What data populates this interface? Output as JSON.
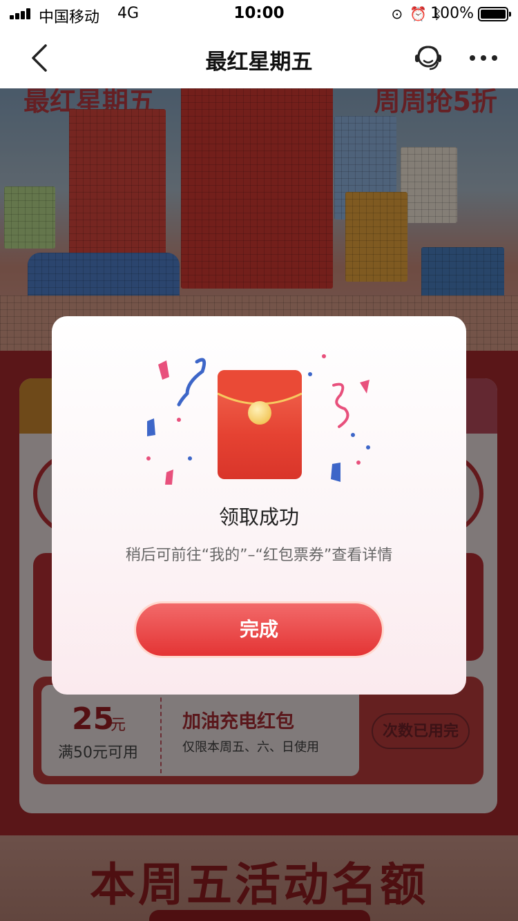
{
  "status_bar": {
    "carrier": "中国移动",
    "network": "4G",
    "time": "10:00",
    "battery": "100%"
  },
  "nav": {
    "title": "最红星期五"
  },
  "hero": {
    "top_left_text": "最红星期五",
    "top_right_text": "周周抢5折"
  },
  "coupon": {
    "amount": "25",
    "unit": "元",
    "condition": "满50元可用",
    "name": "加油充电红包",
    "desc": "仅限本周五、六、日使用",
    "button": "次数已用完"
  },
  "bottom": {
    "title": "本周五活动名额"
  },
  "modal": {
    "title": "领取成功",
    "subtitle": "稍后可前往“我的”–“红包票券”查看详情",
    "done_button": "完成"
  },
  "colors": {
    "accent": "#e43434",
    "envelope": "#e54232",
    "seal": "#f3c85e"
  }
}
